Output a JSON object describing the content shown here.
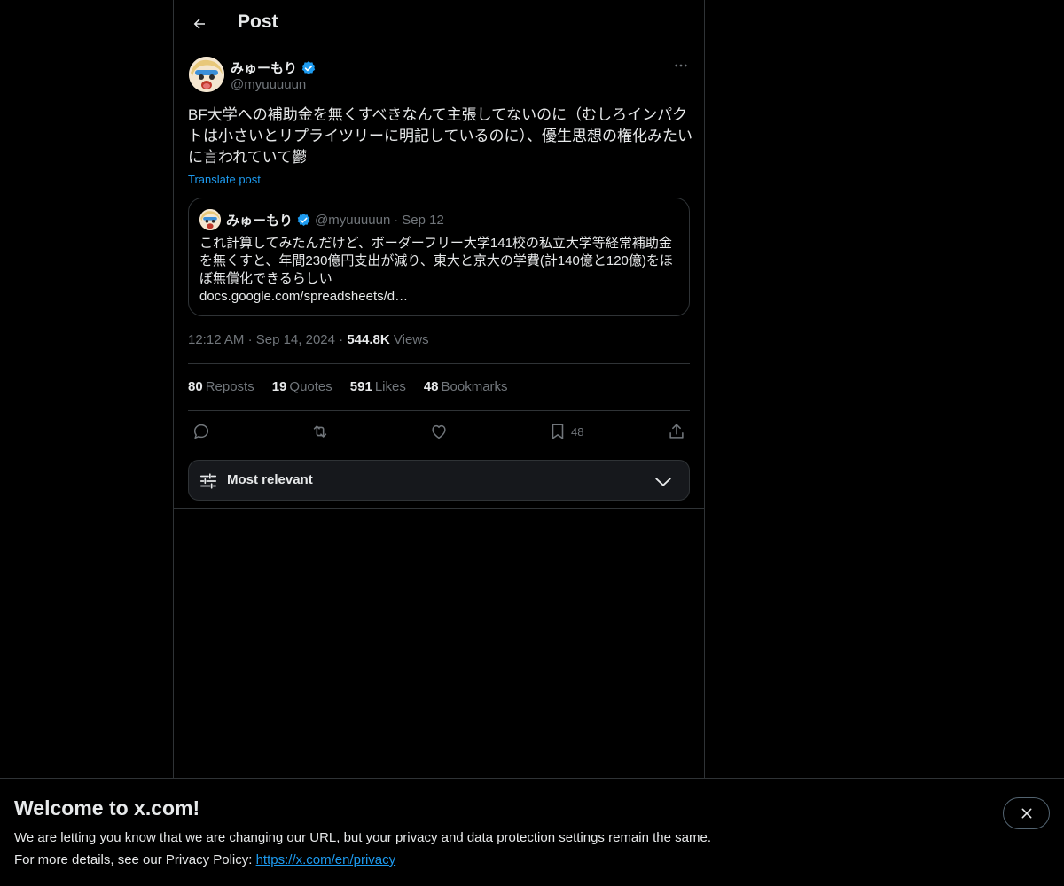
{
  "header": {
    "title": "Post"
  },
  "post": {
    "author": {
      "name": "みゅーもり",
      "handle": "@myuuuuun",
      "verified": true
    },
    "text": "BF大学への補助金を無くすべきなんて主張してないのに（むしろインパクトは小さいとリプライツリーに明記しているのに）、優生思想の権化みたいに言われていて鬱",
    "translate_label": "Translate post",
    "quote": {
      "name": "みゅーもり",
      "handle": "@myuuuuun",
      "separator": "·",
      "date": "Sep 12",
      "text": "これ計算してみたんだけど、ボーダーフリー大学141校の私立大学等経常補助金を無くすと、年間230億円支出が減り、東大と京大の学費(計140億と120億)をほぼ無償化できるらしい",
      "link": "docs.google.com/spreadsheets/d…"
    },
    "meta": {
      "time": "12:12 AM",
      "separator": "·",
      "date": "Sep 14, 2024",
      "views_count": "544.8K",
      "views_label": "Views"
    },
    "stats": [
      {
        "count": "80",
        "label": "Reposts"
      },
      {
        "count": "19",
        "label": "Quotes"
      },
      {
        "count": "591",
        "label": "Likes"
      },
      {
        "count": "48",
        "label": "Bookmarks"
      }
    ],
    "actions": {
      "bookmark_count": "48"
    }
  },
  "sort": {
    "label": "Most relevant"
  },
  "banner": {
    "title": "Welcome to x.com!",
    "line1": "We are letting you know that we are changing our URL, but your privacy and data protection settings remain the same.",
    "line2_prefix": "For more details, see our Privacy Policy: ",
    "link": "https://x.com/en/privacy"
  },
  "icons": {
    "back": "arrow-left-icon",
    "verified": "verified-badge-icon",
    "more": "more-dots-icon",
    "reply": "reply-icon",
    "repost": "repost-icon",
    "like": "heart-icon",
    "bookmark": "bookmark-icon",
    "share": "share-icon",
    "sort": "sliders-icon",
    "chevron": "chevron-down-icon",
    "close": "close-icon"
  },
  "colors": {
    "background": "#000000",
    "text": "#e7e9ea",
    "secondary_text": "#71767b",
    "accent": "#1d9bf0",
    "border": "#2f3336"
  }
}
